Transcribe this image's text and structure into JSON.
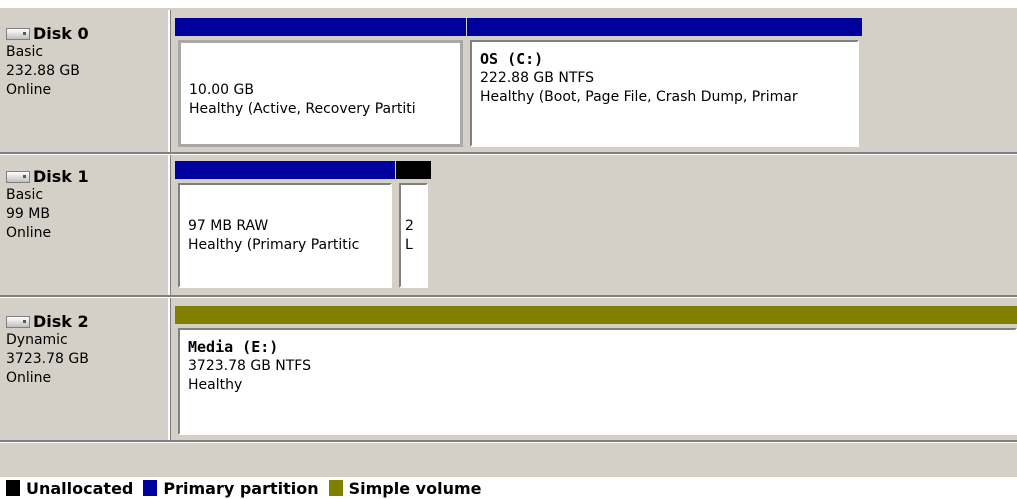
{
  "colors": {
    "primary_partition": "#00009c",
    "simple_volume": "#7f7f00",
    "unallocated": "#000000"
  },
  "disks": [
    {
      "name": "Disk 0",
      "type": "Basic",
      "size": "232.88 GB",
      "status": "Online",
      "partitions": [
        {
          "name": "",
          "size_fs": "10.00 GB",
          "status": "Healthy (Active, Recovery Partiti"
        },
        {
          "name": "OS  (C:)",
          "size_fs": "222.88 GB NTFS",
          "status": "Healthy (Boot, Page File, Crash Dump, Primar"
        }
      ]
    },
    {
      "name": "Disk 1",
      "type": "Basic",
      "size": "99 MB",
      "status": "Online",
      "partitions": [
        {
          "name": "",
          "size_fs": "97 MB RAW",
          "status": "Healthy (Primary Partitic"
        },
        {
          "name": "",
          "size_fs": "2",
          "status": "L"
        }
      ]
    },
    {
      "name": "Disk 2",
      "type": "Dynamic",
      "size": "3723.78 GB",
      "status": "Online",
      "partitions": [
        {
          "name": "Media  (E:)",
          "size_fs": "3723.78 GB NTFS",
          "status": "Healthy"
        }
      ]
    }
  ],
  "legend": [
    {
      "label": "Unallocated"
    },
    {
      "label": "Primary partition"
    },
    {
      "label": "Simple volume"
    }
  ]
}
